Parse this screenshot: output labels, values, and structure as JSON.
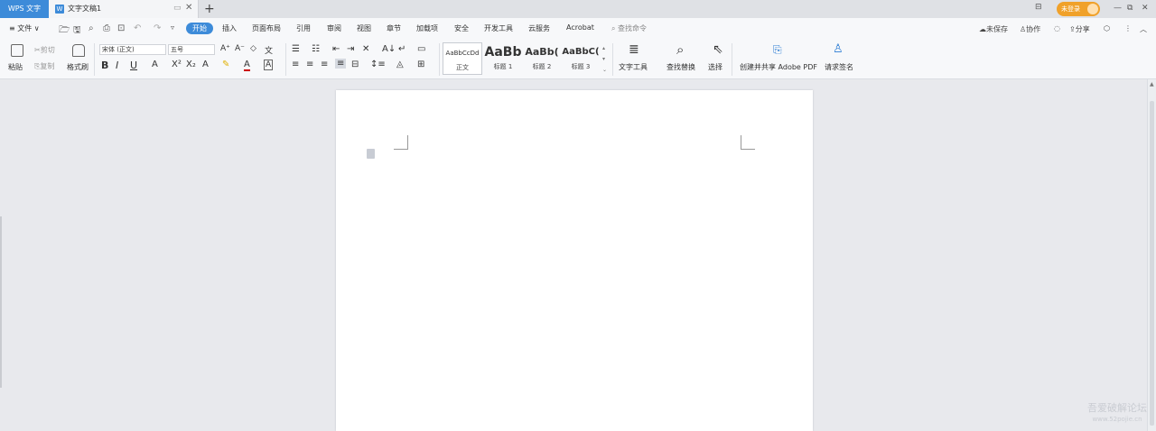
{
  "tabs": {
    "app": "WPS 文字",
    "doc": "文字文稿1",
    "new": "+"
  },
  "titlebar": {
    "login": "未登录"
  },
  "menu": {
    "file": "≡ 文件 ∨",
    "items": [
      "开始",
      "插入",
      "页面布局",
      "引用",
      "审阅",
      "视图",
      "章节",
      "加载项",
      "安全",
      "开发工具",
      "云服务",
      "Acrobat"
    ],
    "search": "查找命令",
    "right": [
      "未保存",
      "协作",
      "分享"
    ]
  },
  "ribbon": {
    "paste": "粘贴",
    "cut": "剪切",
    "copy": "复制",
    "format_painter": "格式刷",
    "font_name": "宋体 (正文)",
    "font_size": "五号",
    "styles": [
      {
        "preview": "AaBbCcDd",
        "label": "正文"
      },
      {
        "preview": "AaBb",
        "label": "标题 1"
      },
      {
        "preview": "AaBb(",
        "label": "标题 2"
      },
      {
        "preview": "AaBbC(",
        "label": "标题 3"
      }
    ],
    "text_tools": "文字工具",
    "find_replace": "查找替换",
    "select": "选择",
    "share_pdf": "创建并共享 Adobe PDF",
    "sign": "请求签名"
  },
  "watermark": {
    "line1": "吾爱破解论坛",
    "line2": "www.52pojie.cn"
  }
}
